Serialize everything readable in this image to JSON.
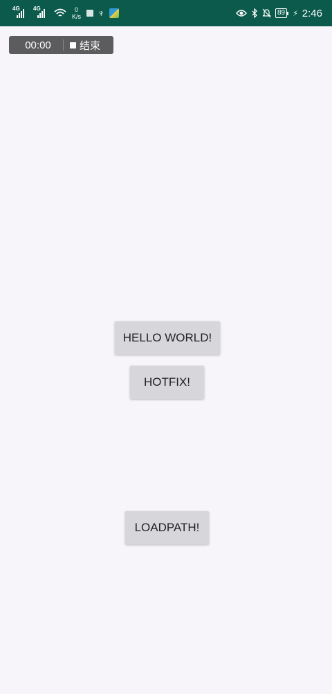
{
  "status_bar": {
    "signal1_label": "4G",
    "signal2_label": "4G",
    "net_speed_value": "0",
    "net_speed_unit": "K/s",
    "battery_level": "89",
    "time": "2:46",
    "background_color": "#0c5a4c",
    "icons": [
      "signal-icon",
      "signal-icon",
      "wifi-icon",
      "notification-square-icon",
      "usb-icon",
      "app-notification-icon",
      "eye-icon",
      "bluetooth-icon",
      "bell-off-icon",
      "battery-icon",
      "charging-icon"
    ]
  },
  "recorder": {
    "elapsed": "00:00",
    "stop_label": "结束"
  },
  "buttons": {
    "hello_world": "HELLO WORLD!",
    "hotfix": "HOTFIX!",
    "loadpath": "LOADPATH!"
  },
  "colors": {
    "page_background": "#f7f5f9",
    "button_background": "#d7d6da",
    "recorder_background": "#5c5c5f"
  }
}
